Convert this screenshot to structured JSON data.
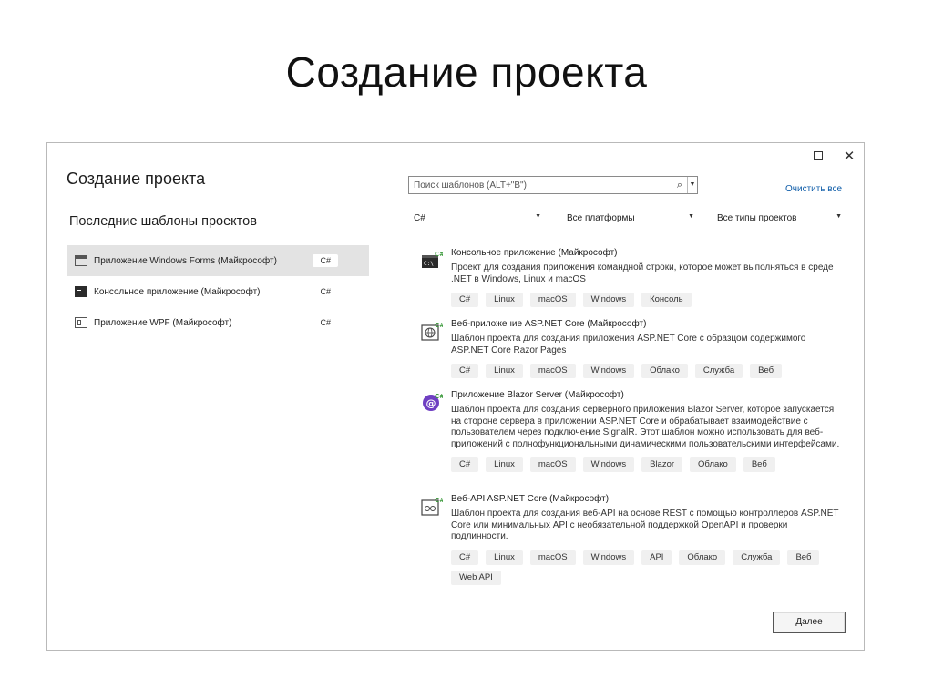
{
  "slide": {
    "title": "Создание проекта"
  },
  "dialog": {
    "title": "Создание проекта",
    "recent_title": "Последние шаблоны проектов",
    "recent_items": [
      {
        "label": "Приложение Windows Forms (Майкрософт)",
        "lang": "C#"
      },
      {
        "label": "Консольное приложение (Майкрософт)",
        "lang": "C#"
      },
      {
        "label": "Приложение WPF (Майкрософт)",
        "lang": "C#"
      }
    ],
    "search": {
      "placeholder": "Поиск шаблонов (ALT+\"В\")"
    },
    "clear_all": "Очистить все",
    "filters": {
      "language": "C#",
      "platform": "Все платформы",
      "project_type": "Все типы проектов"
    },
    "templates": [
      {
        "name": "Консольное приложение (Майкрософт)",
        "desc": "Проект для создания приложения командной строки, которое может выполняться в среде .NET в Windows, Linux и macOS",
        "tags": [
          "C#",
          "Linux",
          "macOS",
          "Windows",
          "Консоль"
        ]
      },
      {
        "name": "Веб-приложение ASP.NET Core (Майкрософт)",
        "desc": "Шаблон проекта для создания приложения ASP.NET Core с образцом содержимого ASP.NET Core Razor Pages",
        "tags": [
          "C#",
          "Linux",
          "macOS",
          "Windows",
          "Облако",
          "Служба",
          "Веб"
        ]
      },
      {
        "name": "Приложение Blazor Server (Майкрософт)",
        "desc": "Шаблон проекта для создания серверного приложения Blazor Server, которое запускается на стороне сервера в приложении ASP.NET Core и обрабатывает взаимодействие с пользователем через подключение SignalR. Этот шаблон можно использовать для веб-приложений с полнофункциональными динамическими пользовательскими интерфейсами.",
        "tags": [
          "C#",
          "Linux",
          "macOS",
          "Windows",
          "Blazor",
          "Облако",
          "Веб"
        ]
      },
      {
        "name": "Веб-API ASP.NET Core (Майкрософт)",
        "desc": "Шаблон проекта для создания веб-API на основе REST с помощью контроллеров ASP.NET Core или минимальных API с необязательной поддержкой OpenAPI и проверки подлинности.",
        "tags": [
          "C#",
          "Linux",
          "macOS",
          "Windows",
          "API",
          "Облако",
          "Служба",
          "Веб",
          "Web API"
        ]
      }
    ],
    "next_button": "Далее",
    "icons": {
      "console": "console-app-icon",
      "aspnet": "web-globe-icon",
      "blazor": "blazor-icon",
      "webapi": "web-api-icon"
    },
    "colors": {
      "accent_green": "#3c9a3c",
      "blazor_purple": "#6f3fc2",
      "link": "#0c5ba8"
    }
  }
}
